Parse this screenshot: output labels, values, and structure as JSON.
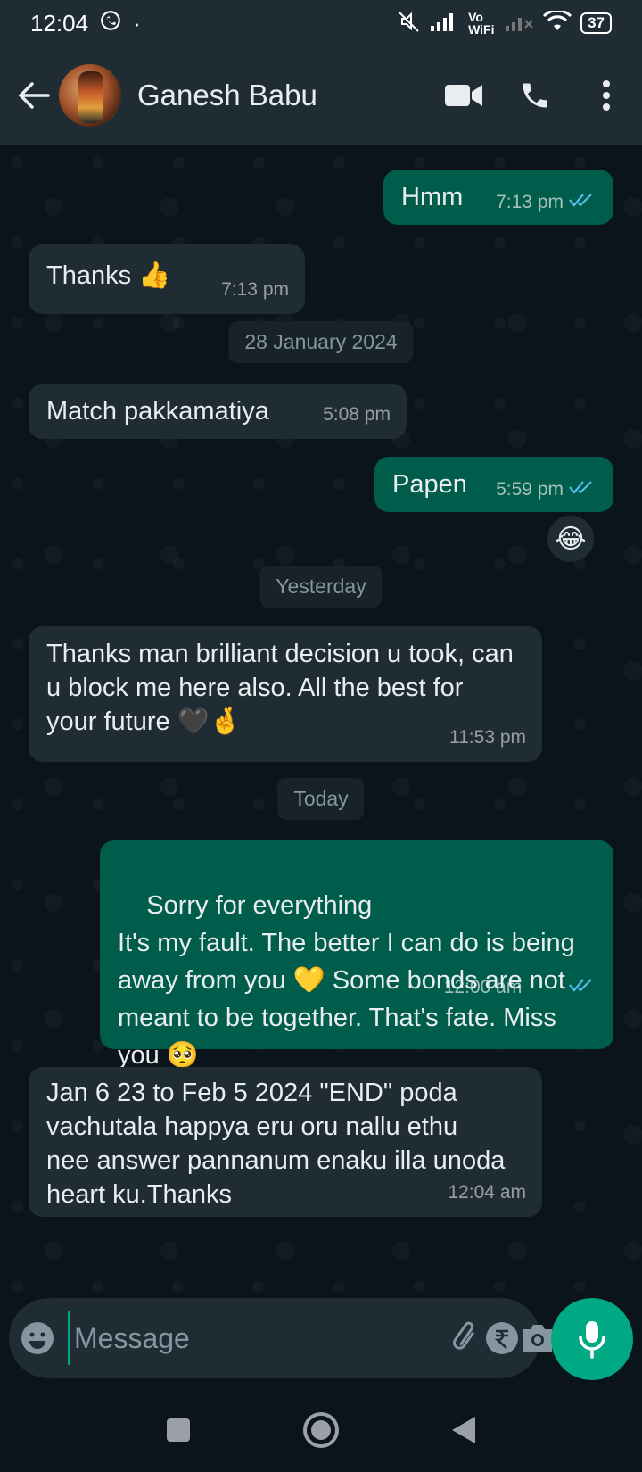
{
  "status_bar": {
    "time": "12:04",
    "dot": "·",
    "battery": "37",
    "network_label": "Vo WiFi"
  },
  "header": {
    "contact_name": "Ganesh Babu"
  },
  "messages": [
    {
      "dir": "out",
      "text": "Hmm",
      "time": "7:13 pm",
      "status": "read"
    },
    {
      "dir": "in",
      "text": "Thanks 👍",
      "time": "7:13 pm"
    },
    {
      "dir": "in",
      "text": "Match pakkamatiya",
      "time": "5:08 pm"
    },
    {
      "dir": "out",
      "text": "Papen",
      "time": "5:59 pm",
      "status": "read",
      "reaction": "😂"
    },
    {
      "dir": "in",
      "text": "Thanks man brilliant decision u took, can u block me here also. All the best for your future 🖤🤞",
      "time": "11:53 pm"
    },
    {
      "dir": "out",
      "text": "Sorry for everything\nIt's my fault. The better I can do is being away from you 💛 Some bonds are not meant to be together. That's fate. Miss you 🥺",
      "time": "12:00 am",
      "status": "read"
    },
    {
      "dir": "in",
      "text": "Jan 6 23 to Feb 5 2024 \"END\" poda vachutala happya eru oru nallu ethu nee answer pannanum enaku illa unoda heart ku.Thanks",
      "time": "12:04 am"
    }
  ],
  "date_separators": [
    "28 January 2024",
    "Yesterday",
    "Today"
  ],
  "composer": {
    "placeholder": "Message"
  },
  "colors": {
    "incoming_bubble": "#1f2c34",
    "outgoing_bubble": "#005c4b",
    "accent": "#00a884",
    "read_ticks": "#53bdeb"
  }
}
